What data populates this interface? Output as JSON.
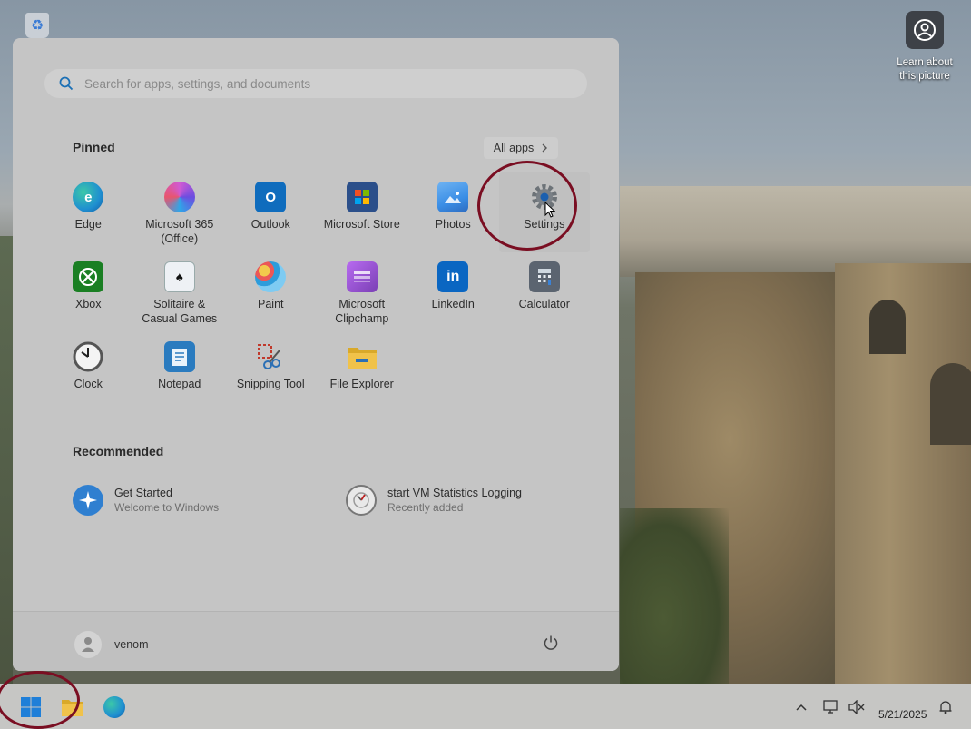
{
  "desktop": {
    "learn_label": "Learn about this picture",
    "recycle_icon": "recycle-bin-icon"
  },
  "start_menu": {
    "search_placeholder": "Search for apps, settings, and documents",
    "pinned_heading": "Pinned",
    "all_apps_label": "All apps",
    "pinned": [
      {
        "name": "Edge",
        "icon": "edge-icon",
        "color": "#1f8fd1"
      },
      {
        "name": "Microsoft 365 (Office)",
        "icon": "microsoft365-icon",
        "color": "#b45fd6"
      },
      {
        "name": "Outlook",
        "icon": "outlook-icon",
        "color": "#0f6cbd"
      },
      {
        "name": "Microsoft Store",
        "icon": "store-icon",
        "color": "#2b4f8a"
      },
      {
        "name": "Photos",
        "icon": "photos-icon",
        "color": "#3a8ee6"
      },
      {
        "name": "Settings",
        "icon": "settings-gear-icon",
        "color": "#6d7378"
      },
      {
        "name": "Xbox",
        "icon": "xbox-icon",
        "color": "#1a7f23"
      },
      {
        "name": "Solitaire & Casual Games",
        "icon": "solitaire-icon",
        "color": "#2a5fa8"
      },
      {
        "name": "Paint",
        "icon": "paint-icon",
        "color": "#3f9ad8"
      },
      {
        "name": "Microsoft Clipchamp",
        "icon": "clipchamp-icon",
        "color": "#7a3fb5"
      },
      {
        "name": "LinkedIn",
        "icon": "linkedin-icon",
        "color": "#0a66c2"
      },
      {
        "name": "Calculator",
        "icon": "calculator-icon",
        "color": "#5b6470"
      },
      {
        "name": "Clock",
        "icon": "clock-icon",
        "color": "#8a8f95"
      },
      {
        "name": "Notepad",
        "icon": "notepad-icon",
        "color": "#2a7bbf"
      },
      {
        "name": "Snipping Tool",
        "icon": "snipping-tool-icon",
        "color": "#c0392b"
      },
      {
        "name": "File Explorer",
        "icon": "file-explorer-icon",
        "color": "#d9a92a"
      }
    ],
    "recommended_heading": "Recommended",
    "recommended": [
      {
        "title": "Get Started",
        "subtitle": "Welcome to Windows",
        "icon": "get-started-icon"
      },
      {
        "title": "start VM Statistics Logging",
        "subtitle": "Recently added",
        "icon": "vm-statistics-icon"
      }
    ],
    "user_name": "venom",
    "power_icon": "power-icon"
  },
  "taskbar": {
    "start_icon": "windows-start-icon",
    "apps": [
      "file-explorer-icon",
      "edge-icon"
    ],
    "tray": [
      "chevron-up-icon",
      "network-icon",
      "volume-muted-icon"
    ],
    "date": "5/21/2025",
    "notification_icon": "notification-bell-icon"
  },
  "colors": {
    "annotation": "#7a0e22",
    "menu_bg": "#c5c5c5",
    "taskbar_bg": "#c6c6c4"
  }
}
